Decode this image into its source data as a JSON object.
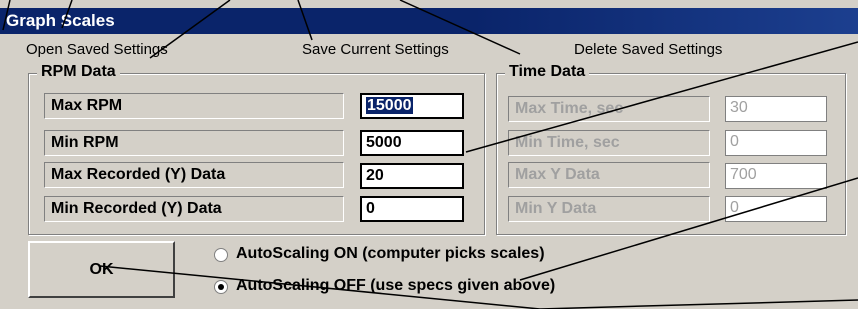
{
  "window": {
    "title": "Graph Scales"
  },
  "menu": {
    "open_saved": "Open Saved Settings",
    "save_current": "Save Current Settings",
    "delete_saved": "Delete Saved Settings"
  },
  "rpm_data": {
    "legend": "RPM Data",
    "max_rpm": {
      "label": "Max RPM",
      "value": "15000"
    },
    "min_rpm": {
      "label": "Min RPM",
      "value": "5000"
    },
    "max_y": {
      "label": "Max Recorded (Y) Data",
      "value": "20"
    },
    "min_y": {
      "label": "Min Recorded (Y) Data",
      "value": "0"
    }
  },
  "time_data": {
    "legend": "Time Data",
    "max_time": {
      "label": "Max Time, sec",
      "value": "30"
    },
    "min_time": {
      "label": "Min Time, sec",
      "value": "0"
    },
    "max_y": {
      "label": "Max Y Data",
      "value": "700"
    },
    "min_y": {
      "label": "Min Y Data",
      "value": "0"
    }
  },
  "ok_button": "OK",
  "autoscaling": {
    "on_label": "AutoScaling ON (computer picks scales)",
    "off_label": "AutoScaling OFF (use specs given above)",
    "selected": "off"
  },
  "colors": {
    "titlebar": "#0a246a",
    "window_bg": "#d4d0c8",
    "selection": "#0a246a",
    "disabled_text": "#a0a0a0"
  }
}
